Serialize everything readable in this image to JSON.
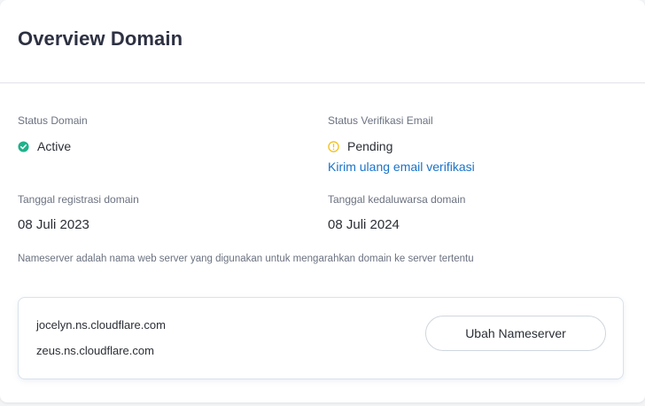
{
  "card": {
    "title": "Overview Domain"
  },
  "status_domain": {
    "label": "Status Domain",
    "value": "Active",
    "icon": "check-circle-icon",
    "color": "#1fb28a"
  },
  "status_email": {
    "label": "Status Verifikasi Email",
    "value": "Pending",
    "icon": "info-circle-icon",
    "color": "#f2c01d",
    "resend_link": "Kirim ulang email verifikasi"
  },
  "registration": {
    "label": "Tanggal registrasi domain",
    "value": "08 Juli 2023"
  },
  "expiry": {
    "label": "Tanggal kedaluwarsa domain",
    "value": "08 Juli 2024"
  },
  "nameserver": {
    "note": "Nameserver adalah nama web server yang digunakan untuk mengarahkan domain ke server tertentu",
    "items": [
      "jocelyn.ns.cloudflare.com",
      "zeus.ns.cloudflare.com"
    ],
    "change_button": "Ubah Nameserver"
  },
  "colors": {
    "link": "#1a73c9",
    "title": "#2d3142"
  }
}
